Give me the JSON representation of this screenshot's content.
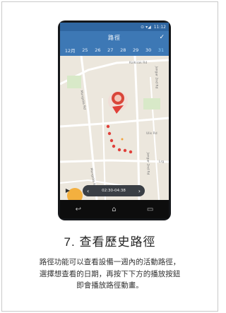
{
  "status_bar": {
    "indicators": "⊙ ▾◢",
    "time": "11:12"
  },
  "app_bar": {
    "title": "路徑",
    "confirm_icon": "checkmark-icon"
  },
  "date_strip": {
    "month": "12月",
    "days": [
      "25",
      "26",
      "27",
      "28",
      "29",
      "30",
      "31"
    ],
    "selected": "31"
  },
  "map": {
    "labels": [
      "Kolkirak Rd",
      "Jangar 2nd Rd",
      "Jangar 2nd Rd",
      "Mongolia Rd",
      "Mongolia Rd",
      "Ulis Rd",
      "Lrg"
    ]
  },
  "playback": {
    "play_icon": "play-icon",
    "prev_icon": "chevron-left-icon",
    "next_icon": "chevron-right-icon",
    "time_range": "02:30-04:38"
  },
  "nav_bar": {
    "icons": [
      "back-icon",
      "home-icon",
      "recent-apps-icon"
    ]
  },
  "step": {
    "title": "7. 查看歷史路徑",
    "description_lines": [
      "路徑功能可以查看設備一週內的活動路徑，",
      "選擇想查看的日期，再按下下方的播放按鈕",
      "即會播放路徑動畫。"
    ]
  },
  "colors": {
    "app_bar": "#3d78b5",
    "selected_day": "#8fd3ff",
    "route_dot": "#e0403a",
    "playback_orb": "#f4a623"
  }
}
